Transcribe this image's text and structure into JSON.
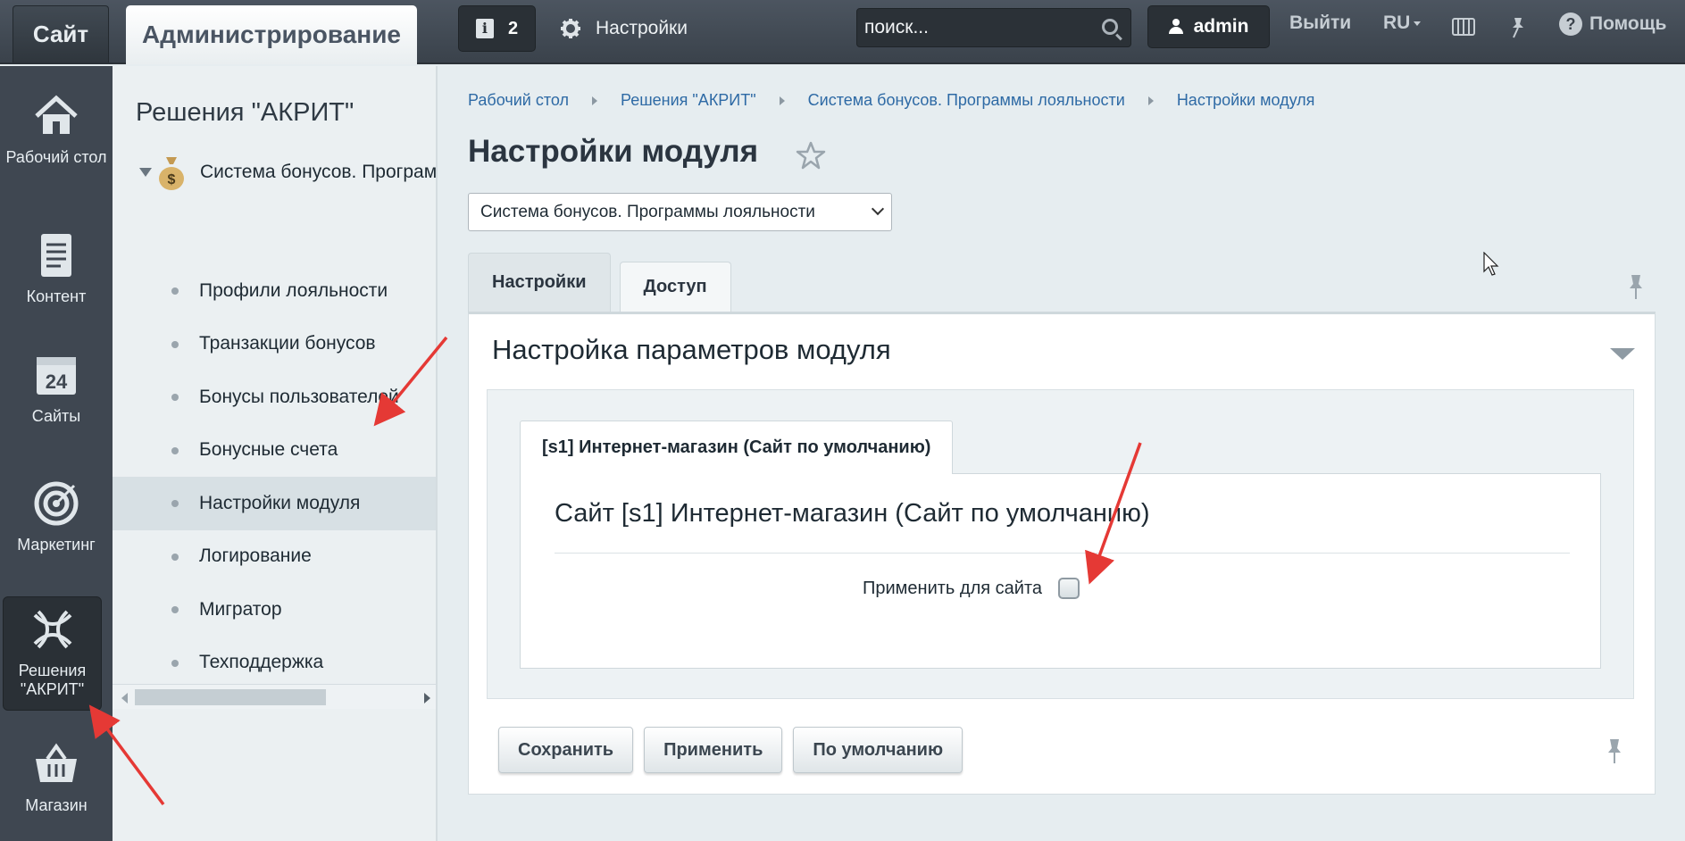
{
  "topbar": {
    "site_label": "Сайт",
    "admin_label": "Администрирование",
    "notifications_count": "2",
    "settings_label": "Настройки",
    "search_placeholder": "поиск...",
    "user_name": "admin",
    "logout_label": "Выйти",
    "lang_label": "RU",
    "help_label": "Помощь"
  },
  "leftmenu": {
    "items": [
      {
        "label": "Рабочий стол",
        "icon": "home-icon"
      },
      {
        "label": "Контент",
        "icon": "document-icon"
      },
      {
        "label": "Сайты",
        "icon": "calendar-icon",
        "icon_text": "24"
      },
      {
        "label": "Маркетинг",
        "icon": "target-icon"
      },
      {
        "label": "Решения \"АКРИТ\"",
        "icon": "akrit-icon",
        "active": true
      },
      {
        "label": "Магазин",
        "icon": "basket-icon"
      }
    ]
  },
  "submenu": {
    "title": "Решения \"АКРИТ\"",
    "root_item": "Система бонусов. Программы лояльности",
    "items": [
      {
        "label": "Профили лояльности"
      },
      {
        "label": "Транзакции бонусов"
      },
      {
        "label": "Бонусы пользователей"
      },
      {
        "label": "Бонусные счета"
      },
      {
        "label": "Настройки модуля",
        "active": true
      },
      {
        "label": "Логирование"
      },
      {
        "label": "Мигратор"
      },
      {
        "label": "Техподдержка"
      }
    ]
  },
  "main": {
    "breadcrumb": [
      "Рабочий стол",
      "Решения \"АКРИТ\"",
      "Система бонусов. Программы лояльности",
      "Настройки модуля"
    ],
    "title": "Настройки модуля",
    "module_select": "Система бонусов. Программы лояльности",
    "tabs": [
      {
        "label": "Настройки",
        "active": true
      },
      {
        "label": "Доступ",
        "active": false
      }
    ],
    "panel_title": "Настройка параметров модуля",
    "site_tab": "[s1] Интернет-магазин (Сайт по умолчанию)",
    "site_heading": "Сайт [s1] Интернет-магазин (Сайт по умолчанию)",
    "apply_label": "Применить для сайта",
    "apply_checked": false,
    "buttons": {
      "save": "Сохранить",
      "apply": "Применить",
      "default": "По умолчанию"
    }
  },
  "colors": {
    "topbar": "#3a424b",
    "link": "#2e6aa5",
    "annotation_arrow": "#e53935"
  }
}
